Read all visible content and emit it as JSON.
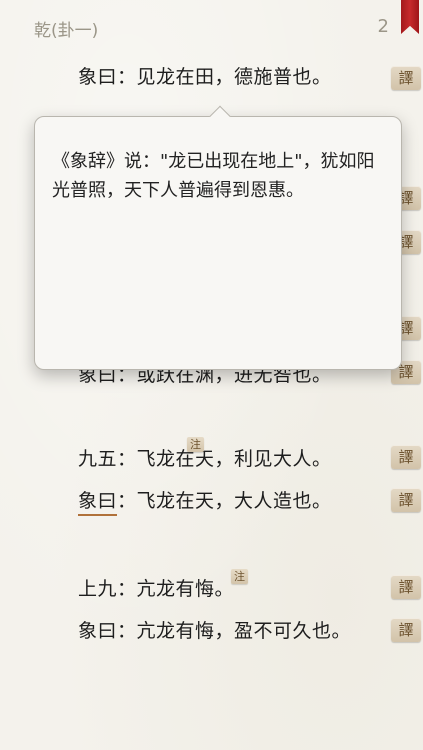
{
  "header": {
    "title": "乾(卦一)",
    "page_number": "2"
  },
  "translate_label": "譯",
  "note_label": "注",
  "lines": [
    {
      "text": "象曰：见龙在田，德施普也。"
    },
    {
      "text": "象曰：或跃在渊，进无咎也。"
    },
    {
      "label": "九五：",
      "text": "飞龙在天，利见大人。"
    },
    {
      "label": "象曰",
      "sep": "：",
      "text": "飞龙在天，大人造也。"
    },
    {
      "label": "上九：",
      "text": "亢龙有悔。"
    },
    {
      "text": "象曰：亢龙有悔，盈不可久也。"
    }
  ],
  "popup": {
    "text": "《象辞》说：\"龙已出现在地上\"，犹如阳光普照，天下人普遍得到恩惠。"
  }
}
